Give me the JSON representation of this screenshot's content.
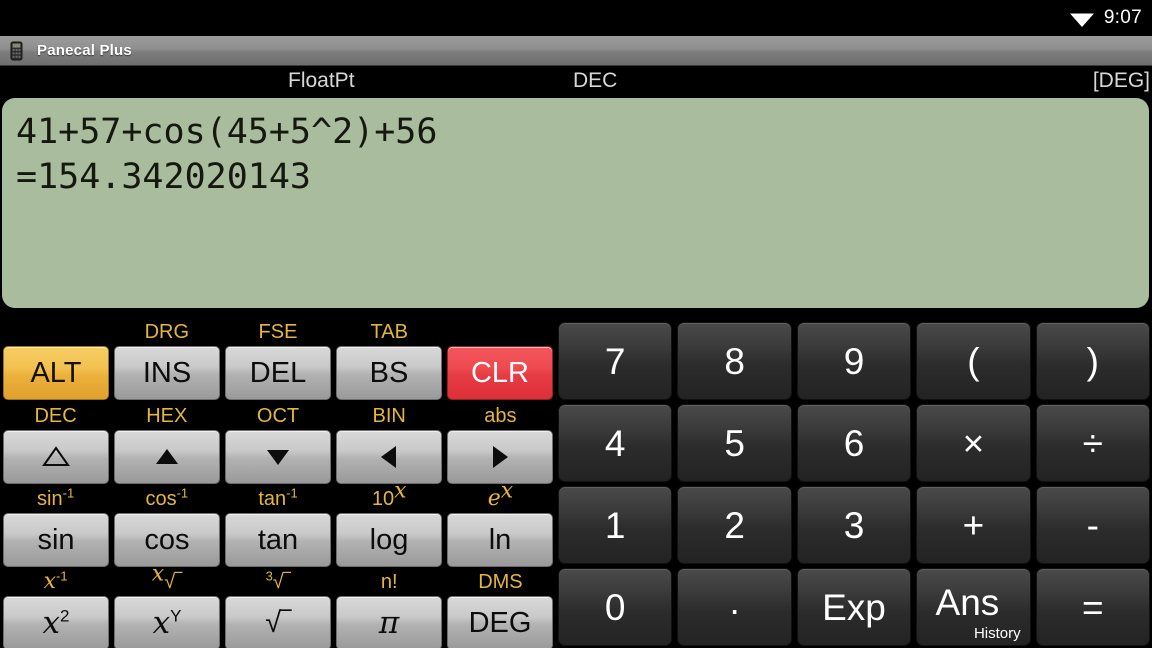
{
  "status_bar": {
    "wifi_icon": "wifi-icon",
    "time": "9:07"
  },
  "title_bar": {
    "app_icon": "calculator-app-icon",
    "title": "Panecal Plus"
  },
  "mode_row": {
    "notation": "FloatPt",
    "base": "DEC",
    "angle": "[DEG]"
  },
  "display": {
    "expression": "41+57+cos(45+5^2)+56",
    "result": "=154.342020143",
    "background_color": "#a9bd9e",
    "text_color": "#14180f"
  },
  "colors": {
    "gold_label": "#e5b63c",
    "alt_key": "#f2c150",
    "clr_key": "#ee4a50",
    "grey_key": "#c9c9c9",
    "dark_key": "#3b3b3b"
  },
  "left_keypad": {
    "rows": [
      {
        "shift_labels": [
          "",
          "DRG",
          "FSE",
          "TAB",
          ""
        ],
        "keys": [
          {
            "label": "ALT",
            "name": "alt-key",
            "style": "alt"
          },
          {
            "label": "INS",
            "name": "ins-key",
            "style": "grey"
          },
          {
            "label": "DEL",
            "name": "del-key",
            "style": "grey"
          },
          {
            "label": "BS",
            "name": "bs-key",
            "style": "grey"
          },
          {
            "label": "CLR",
            "name": "clr-key",
            "style": "clr"
          }
        ]
      },
      {
        "shift_labels": [
          "DEC",
          "HEX",
          "OCT",
          "BIN",
          "abs"
        ],
        "keys": [
          {
            "label": "△",
            "name": "triangle-outline-up-icon",
            "style": "grey"
          },
          {
            "label": "▲",
            "name": "triangle-up-icon",
            "style": "grey"
          },
          {
            "label": "▼",
            "name": "triangle-down-icon",
            "style": "grey"
          },
          {
            "label": "◀",
            "name": "triangle-left-icon",
            "style": "grey"
          },
          {
            "label": "▶",
            "name": "triangle-right-icon",
            "style": "grey"
          }
        ]
      },
      {
        "shift_labels": [
          "sin-1",
          "cos-1",
          "tan-1",
          "10x",
          "ex"
        ],
        "keys": [
          {
            "label": "sin",
            "name": "sin-key",
            "style": "grey"
          },
          {
            "label": "cos",
            "name": "cos-key",
            "style": "grey"
          },
          {
            "label": "tan",
            "name": "tan-key",
            "style": "grey"
          },
          {
            "label": "log",
            "name": "log-key",
            "style": "grey"
          },
          {
            "label": "ln",
            "name": "ln-key",
            "style": "grey"
          }
        ]
      },
      {
        "shift_labels": [
          "x-1",
          "x-root",
          "3-root",
          "n!",
          "DMS"
        ],
        "keys": [
          {
            "label": "x2",
            "name": "x-squared-key",
            "style": "grey"
          },
          {
            "label": "xY",
            "name": "x-power-y-key",
            "style": "grey"
          },
          {
            "label": "√",
            "name": "square-root-key",
            "style": "grey"
          },
          {
            "label": "π",
            "name": "pi-key",
            "style": "grey"
          },
          {
            "label": "DEG",
            "name": "deg-key",
            "style": "grey"
          }
        ]
      }
    ],
    "shift_text": {
      "drg": "DRG",
      "fse": "FSE",
      "tab": "TAB",
      "dec": "DEC",
      "hex": "HEX",
      "oct": "OCT",
      "bin": "BIN",
      "abs": "abs",
      "sin_base": "sin",
      "cos_base": "cos",
      "tan_base": "tan",
      "inv_sup": "-1",
      "ten_base": "10",
      "ten_sup": "x",
      "e_base": "e",
      "e_sup": "x",
      "x_base": "x",
      "x_inv_sup": "-1",
      "x_root_pre": "x",
      "three_root_pre": "3",
      "root_glyph": "√‾",
      "nfact": "n!",
      "dms": "DMS"
    }
  },
  "right_keypad": {
    "rows": [
      [
        {
          "label": "7",
          "name": "digit-7-key"
        },
        {
          "label": "8",
          "name": "digit-8-key"
        },
        {
          "label": "9",
          "name": "digit-9-key"
        },
        {
          "label": "(",
          "name": "left-paren-key"
        },
        {
          "label": ")",
          "name": "right-paren-key"
        }
      ],
      [
        {
          "label": "4",
          "name": "digit-4-key"
        },
        {
          "label": "5",
          "name": "digit-5-key"
        },
        {
          "label": "6",
          "name": "digit-6-key"
        },
        {
          "label": "×",
          "name": "multiply-key"
        },
        {
          "label": "÷",
          "name": "divide-key"
        }
      ],
      [
        {
          "label": "1",
          "name": "digit-1-key"
        },
        {
          "label": "2",
          "name": "digit-2-key"
        },
        {
          "label": "3",
          "name": "digit-3-key"
        },
        {
          "label": "+",
          "name": "plus-key"
        },
        {
          "label": "-",
          "name": "minus-key"
        }
      ],
      [
        {
          "label": "0",
          "name": "digit-0-key"
        },
        {
          "label": ".",
          "name": "decimal-point-key"
        },
        {
          "label": "Exp",
          "name": "exp-key"
        },
        {
          "label": "Ans",
          "name": "ans-key",
          "sub_label": "History"
        },
        {
          "label": "=",
          "name": "equals-key"
        }
      ]
    ]
  }
}
